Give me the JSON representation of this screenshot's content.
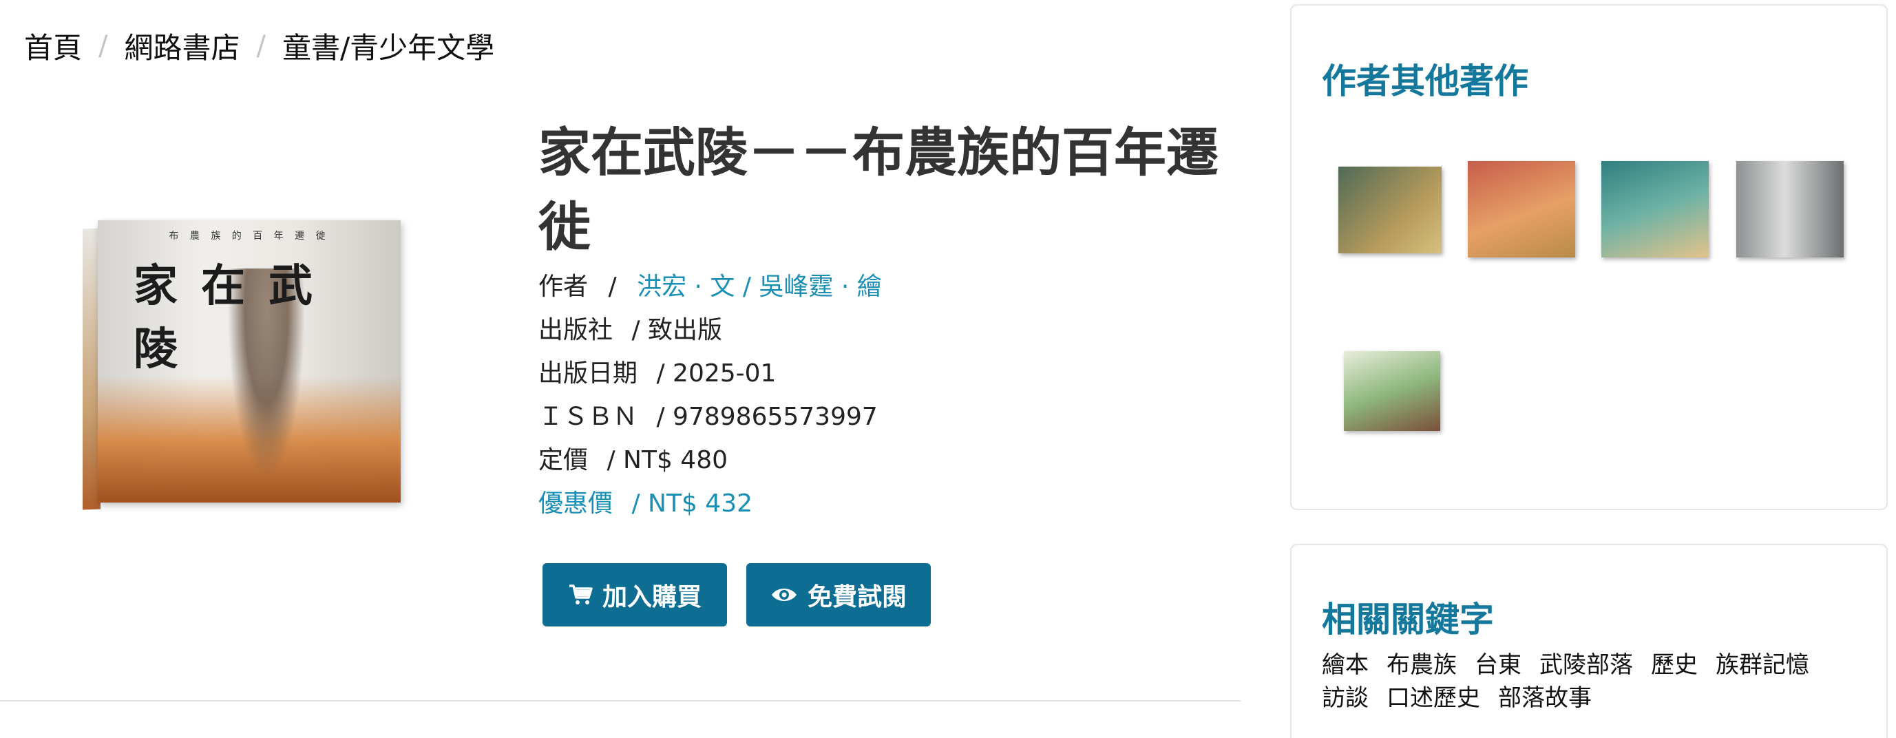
{
  "breadcrumb": {
    "items": [
      "首頁",
      "網路書店",
      "童書/青少年文學"
    ],
    "separator": "/"
  },
  "book": {
    "cover": {
      "top_text": "布 農 族 的 百 年 遷 徙",
      "title": "家在武陵"
    },
    "title": "家在武陵－－布農族的百年遷徙",
    "meta": {
      "author_label": "作者",
      "sep": "/",
      "authors": "洪宏 · 文 / 吳峰霆 · 繪",
      "publisher_label": "出版社",
      "publisher": "/ 致出版",
      "date_label": "出版日期",
      "date": "/ 2025-01",
      "isbn_label": "ＩＳＢＮ",
      "isbn": "/ 9789865573997",
      "price_label": "定價",
      "price": "/ NT$ 480",
      "sale_label": "優惠價",
      "sale_price": "/  NT$ 432"
    }
  },
  "actions": {
    "buy_label": "加入購買",
    "preview_label": "免費試閱"
  },
  "sidebar": {
    "other_works_title": "作者其他著作",
    "other_works": [
      {
        "color": "#6d7a4e"
      },
      {
        "color": "#c7704a"
      },
      {
        "color": "#3e8a85"
      },
      {
        "color": "#5b5f60"
      },
      {
        "color": "#8db07a"
      }
    ],
    "keywords_title": "相關關鍵字",
    "keywords": [
      "繪本",
      "布農族",
      "台東",
      "武陵部落",
      "歷史",
      "族群記憶",
      "訪談",
      "口述歷史",
      "部落故事"
    ]
  },
  "colors": {
    "accent": "#14789c",
    "link": "#1a8fb5",
    "button": "#0e6d93"
  }
}
